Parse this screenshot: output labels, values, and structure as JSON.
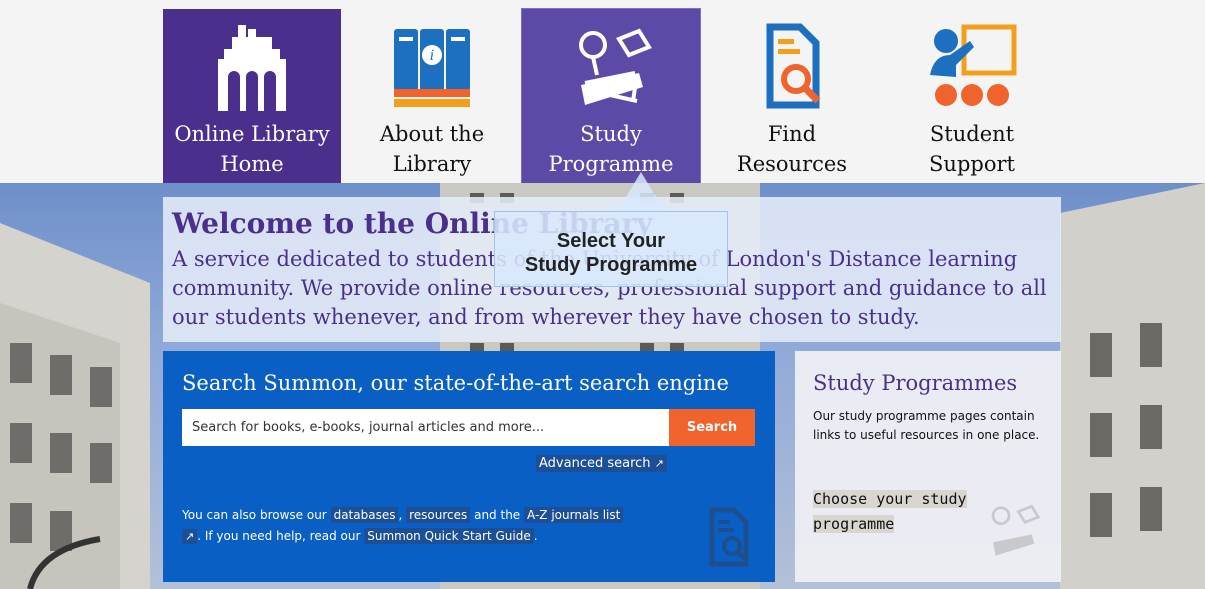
{
  "nav": {
    "home": {
      "line1": "Online Library",
      "line2": "Home",
      "icon": "building-icon"
    },
    "about": {
      "line1": "About the",
      "line2": "Library",
      "icon": "books-info-icon"
    },
    "study": {
      "line1": "Study",
      "line2": "Programme",
      "icon": "study-desk-icon"
    },
    "find": {
      "line1": "Find",
      "line2": "Resources",
      "icon": "document-search-icon"
    },
    "support": {
      "line1": "Student",
      "line2": "Support",
      "icon": "teacher-board-icon"
    }
  },
  "tooltip": {
    "line1": "Select Your",
    "line2": "Study Programme"
  },
  "welcome": {
    "title": "Welcome to the Online Library",
    "text": "A service dedicated to students of the University of London's Distance learning community. We provide online resources, professional support and guidance to all our students whenever, and from wherever they have chosen to study."
  },
  "search": {
    "title": "Search Summon, our state-of-the-art search engine",
    "placeholder": "Search for books, e-books, journal articles and more...",
    "button": "Search",
    "advanced": "Advanced search",
    "browse_prefix": "You can also browse our",
    "databases": "databases",
    "resources": "resources",
    "and_the": "and the",
    "az_list": "A-Z journals list",
    "help_text": ". If you need help, read our",
    "guide": "Summon Quick Start Guide",
    "end": "."
  },
  "study_programmes": {
    "title": "Study Programmes",
    "text": "Our study programme pages contain links to useful resources in one place.",
    "link": "Choose your study programme"
  },
  "colors": {
    "purple": "#4b2f8c",
    "purple_light": "#5c4aa6",
    "search_blue": "#0a5fc4",
    "search_orange": "#f0632c"
  }
}
